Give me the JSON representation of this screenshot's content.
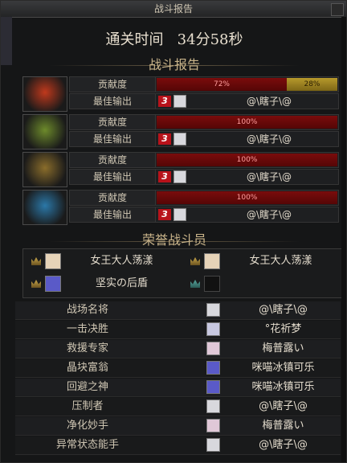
{
  "window": {
    "title": "战斗报告"
  },
  "header": {
    "clear_time_label": "通关时间",
    "clear_time_value": "34分58秒"
  },
  "battle_report": {
    "title": "战斗报告",
    "players": [
      {
        "contribution_label": "贡献度",
        "best_output_label": "最佳输出",
        "contribution_primary": "72%",
        "contribution_secondary": "28%",
        "primary_pct": 72,
        "secondary_pct": 28,
        "rank": "3",
        "best_name": "@\\瞎子\\@",
        "avatar_color": "#c0391c"
      },
      {
        "contribution_label": "贡献度",
        "best_output_label": "最佳输出",
        "contribution_primary": "100%",
        "primary_pct": 100,
        "rank": "3",
        "best_name": "@\\瞎子\\@",
        "avatar_color": "#6d8a2b"
      },
      {
        "contribution_label": "贡献度",
        "best_output_label": "最佳输出",
        "contribution_primary": "100%",
        "primary_pct": 100,
        "rank": "3",
        "best_name": "@\\瞎子\\@",
        "avatar_color": "#8a6d2b"
      },
      {
        "contribution_label": "贡献度",
        "best_output_label": "最佳输出",
        "contribution_primary": "100%",
        "primary_pct": 100,
        "rank": "3",
        "best_name": "@\\瞎子\\@",
        "avatar_color": "#2b78a8"
      }
    ]
  },
  "honor": {
    "title": "荣誉战斗员",
    "members": [
      {
        "name": "女王大人荡漾"
      },
      {
        "name": "女王大人荡漾"
      },
      {
        "name": "坚实の后盾"
      },
      {
        "name": ""
      }
    ]
  },
  "awards": [
    {
      "title": "战场名将",
      "name": "@\\瞎子\\@"
    },
    {
      "title": "一击决胜",
      "name": "°花祈梦"
    },
    {
      "title": "救援专家",
      "name": "梅普露い"
    },
    {
      "title": "晶块富翁",
      "name": "咪喵冰镇可乐"
    },
    {
      "title": "回避之神",
      "name": "咪喵冰镇可乐"
    },
    {
      "title": "压制者",
      "name": "@\\瞎子\\@"
    },
    {
      "title": "净化妙手",
      "name": "梅普露い"
    },
    {
      "title": "异常状态能手",
      "name": "@\\瞎子\\@"
    }
  ],
  "colors": {
    "bar_red": "#7a0c0c",
    "bar_gold": "#b79a2c",
    "title_gold": "#c9b48a"
  },
  "icons": {
    "rank": "rank-3-badge",
    "crown": "crown-icon",
    "close": "close-icon"
  }
}
